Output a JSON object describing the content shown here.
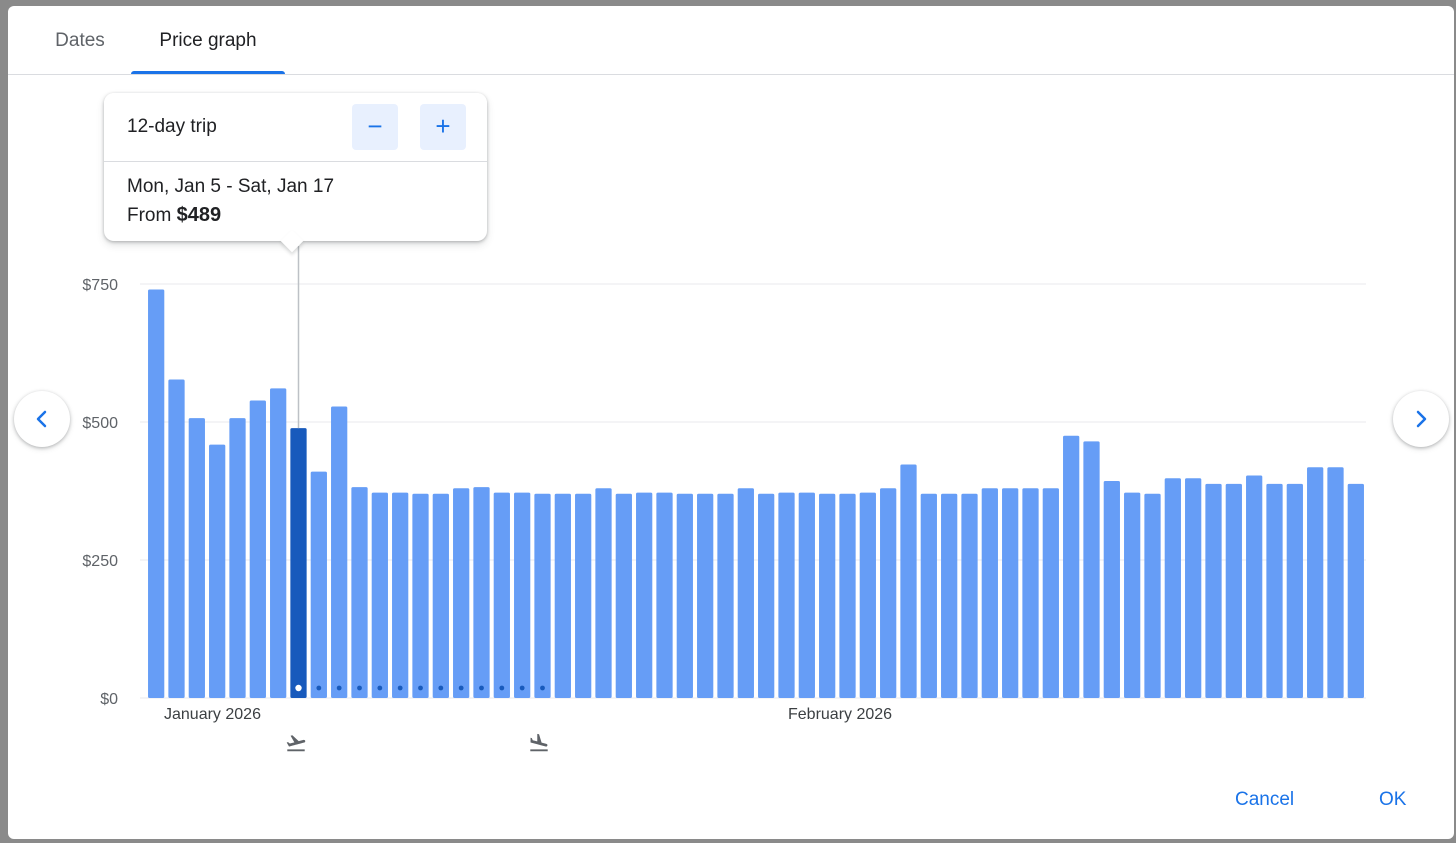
{
  "tabs": [
    {
      "label": "Dates",
      "selected": false
    },
    {
      "label": "Price graph",
      "selected": true
    }
  ],
  "tooltip": {
    "trip_length": "12-day trip",
    "date_range": "Mon, Jan 5 - Sat, Jan 17",
    "price_prefix": "From",
    "price": "$489",
    "decrease_symbol": "−",
    "increase_symbol": "+"
  },
  "chart_data": {
    "type": "bar",
    "yticks": [
      "$0",
      "$250",
      "$500",
      "$750"
    ],
    "ylim": [
      0,
      750
    ],
    "xlabels": [
      "January 2026",
      "February 2026"
    ],
    "grid": true,
    "selected_index": 7,
    "trip_span_indices": [
      7,
      8,
      9,
      10,
      11,
      12,
      13,
      14,
      15,
      16,
      17,
      18,
      19
    ],
    "values": [
      740,
      577,
      507,
      459,
      507,
      539,
      561,
      489,
      410,
      528,
      382,
      372,
      372,
      370,
      370,
      380,
      382,
      372,
      372,
      370,
      370,
      370,
      380,
      370,
      372,
      372,
      370,
      370,
      370,
      380,
      370,
      372,
      372,
      370,
      370,
      372,
      380,
      423,
      370,
      370,
      370,
      380,
      380,
      380,
      380,
      475,
      465,
      393,
      372,
      370,
      398,
      398,
      388,
      388,
      403,
      388,
      388,
      418,
      418,
      388
    ],
    "colors": {
      "bar": "#669df6",
      "selected_bar": "#185abc",
      "grid": "#e8eaed"
    }
  },
  "legend": {
    "depart_icon": "flight-takeoff-icon",
    "return_icon": "flight-land-icon"
  },
  "actions": {
    "cancel": "Cancel",
    "ok": "OK"
  },
  "accent_color": "#1a73e8"
}
